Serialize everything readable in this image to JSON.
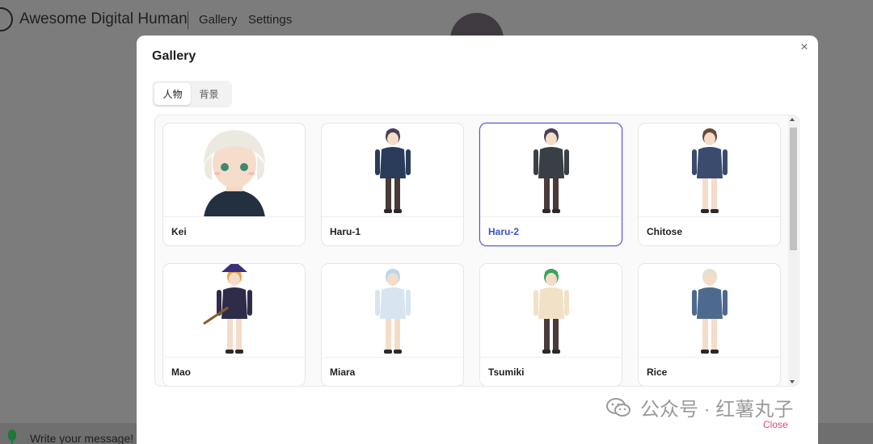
{
  "app": {
    "title": "Awesome Digital Human",
    "nav": [
      "Gallery",
      "Settings"
    ],
    "input_placeholder": "Write your message!"
  },
  "modal": {
    "title": "Gallery",
    "tabs": [
      {
        "label": "人物",
        "active": true
      },
      {
        "label": "背景",
        "active": false
      }
    ],
    "selected": "Haru-2",
    "items": [
      {
        "name": "Kei",
        "hair": "#ece9e1",
        "outfit": "#233040"
      },
      {
        "name": "Haru-1",
        "hair": "#4b3f55",
        "outfit": "#2a3c5a"
      },
      {
        "name": "Haru-2",
        "hair": "#4b3f55",
        "outfit": "#3a3e45"
      },
      {
        "name": "Chitose",
        "hair": "#6a4a3a",
        "outfit": "#3a4b6e"
      },
      {
        "name": "Mao",
        "hair": "#e7a454",
        "outfit": "#2f2c4a"
      },
      {
        "name": "Miara",
        "hair": "#b9d6ea",
        "outfit": "#d8e5f0"
      },
      {
        "name": "Tsumiki",
        "hair": "#3aa55a",
        "outfit": "#f1e1c6"
      },
      {
        "name": "Rice",
        "hair": "#e4e0d2",
        "outfit": "#4d6a8e"
      }
    ],
    "close_label": "Close"
  },
  "watermark": "公众号 · 红薯丸子",
  "colors": {
    "accent": "#4b4fd6",
    "close": "#e0427a"
  }
}
